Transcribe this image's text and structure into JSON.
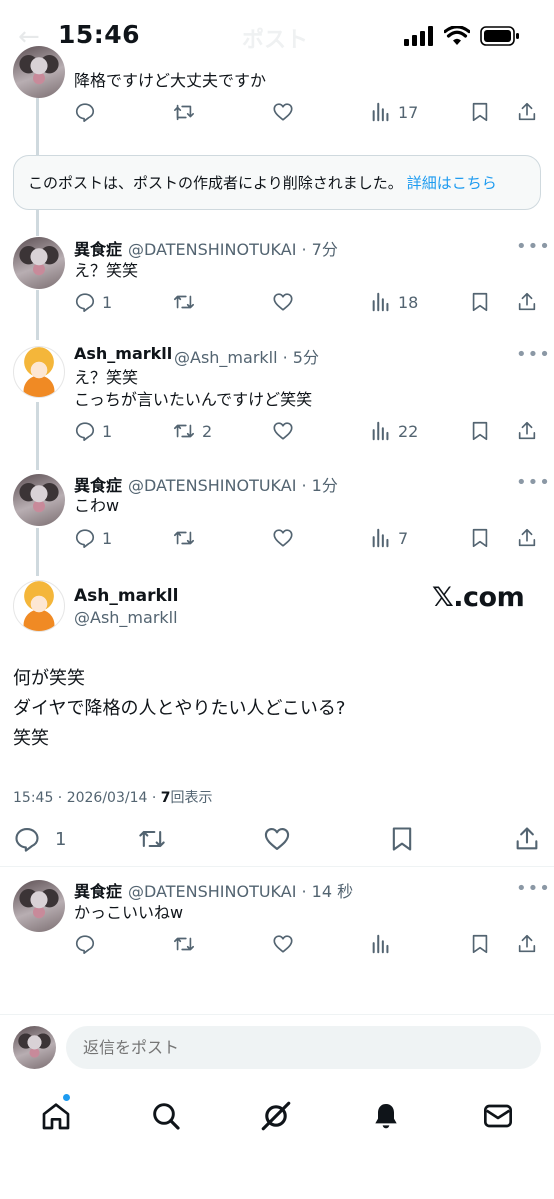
{
  "status": {
    "time": "15:46"
  },
  "header": {
    "back_glyph": "←",
    "title": "ポスト"
  },
  "posts": [
    {
      "text": "降格ですけど大丈夫ですか",
      "reply": "",
      "repost": "",
      "views": "17"
    },
    {
      "name": "異食症",
      "meta": "@DATENSHINOTUKAI · 7分",
      "lines": [
        "え？笑笑"
      ],
      "reply": "1",
      "repost": "",
      "views": "18"
    },
    {
      "name": "Ash_markll",
      "meta": "@Ash_markll · 5分",
      "lines": [
        "え？笑笑",
        "こっちが言いたいんですけど笑笑"
      ],
      "reply": "1",
      "repost": "2",
      "views": "22"
    },
    {
      "name": "異食症",
      "meta": "@DATENSHINOTUKAI · 1分",
      "lines": [
        "こわw"
      ],
      "reply": "1",
      "repost": "",
      "views": "7"
    }
  ],
  "deleted": {
    "text": "このポストは、ポストの作成者により削除されました。",
    "link": "詳細はこちら"
  },
  "main_post": {
    "name": "Ash_markll",
    "handle": "@Ash_markll",
    "watermark": "𝕏.com",
    "lines": [
      "何が笑笑",
      "ダイヤで降格の人とやりたい人どこいる?",
      "笑笑"
    ],
    "timestamp": "15:45 · 2026/03/14 · ",
    "views_count": "7",
    "views_label": "回表示",
    "reply_count": "1"
  },
  "latest_reply": {
    "name": "異食症",
    "meta": "@DATENSHINOTUKAI · 14 秒",
    "text": "かっこいいねw"
  },
  "composer": {
    "placeholder": "返信をポスト"
  },
  "more_glyph": "•••",
  "nav": [
    "home-icon",
    "search-icon",
    "grok-icon",
    "notifications-icon",
    "messages-icon"
  ],
  "colors": {
    "accent": "#1d9bf0",
    "text": "#0f1419",
    "secondary": "#536471"
  }
}
